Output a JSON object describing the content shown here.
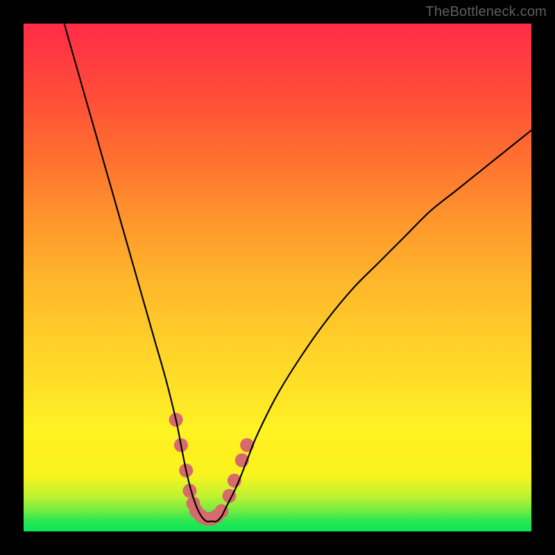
{
  "watermark": "TheBottleneck.com",
  "chart_data": {
    "type": "line",
    "title": "",
    "xlabel": "",
    "ylabel": "",
    "xlim": [
      0,
      100
    ],
    "ylim": [
      0,
      100
    ],
    "series": [
      {
        "name": "bottleneck-curve",
        "x": [
          8,
          10,
          12,
          14,
          16,
          18,
          20,
          22,
          24,
          26,
          28,
          30,
          31,
          32,
          33,
          34,
          35,
          36,
          37,
          38,
          39,
          40,
          42,
          44,
          46,
          50,
          55,
          60,
          65,
          70,
          75,
          80,
          85,
          90,
          95,
          100
        ],
        "values": [
          100,
          93,
          86,
          79,
          72,
          65,
          58,
          51,
          44,
          37,
          30,
          22,
          17,
          12,
          8,
          5,
          3,
          2,
          2,
          2,
          3,
          5,
          9,
          14,
          19,
          27,
          35,
          42,
          48,
          53,
          58,
          63,
          67,
          71,
          75,
          79
        ]
      }
    ],
    "annotations": [
      {
        "name": "highlight-dots",
        "points": [
          {
            "x": 30,
            "y": 22
          },
          {
            "x": 31,
            "y": 17
          },
          {
            "x": 32,
            "y": 12
          },
          {
            "x": 32.7,
            "y": 8
          },
          {
            "x": 33.4,
            "y": 5.5
          },
          {
            "x": 34,
            "y": 4
          },
          {
            "x": 35,
            "y": 3
          },
          {
            "x": 36,
            "y": 2.5
          },
          {
            "x": 37,
            "y": 2.5
          },
          {
            "x": 38,
            "y": 3
          },
          {
            "x": 39,
            "y": 4
          },
          {
            "x": 40.5,
            "y": 7
          },
          {
            "x": 41.5,
            "y": 10
          },
          {
            "x": 43,
            "y": 14
          },
          {
            "x": 44,
            "y": 17
          }
        ],
        "color": "#d76a6c",
        "radius": 10
      }
    ]
  }
}
